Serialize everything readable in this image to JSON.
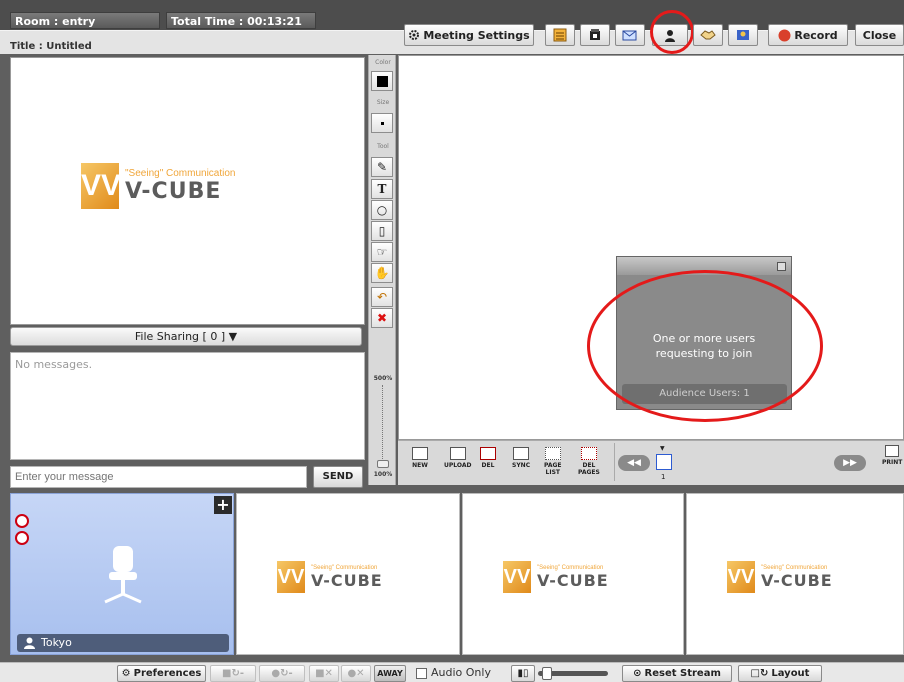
{
  "header": {
    "room": "Room : entry",
    "total_time": "Total Time : 00:13:21",
    "title": "Title : Untitled"
  },
  "toolbar": {
    "meeting_settings": "Meeting Settings",
    "record": "Record",
    "close": "Close"
  },
  "logo": {
    "tagline": "\"Seeing\" Communication",
    "brand": "V-CUBE",
    "mark": "VV"
  },
  "file_sharing": {
    "label": "File Sharing [ 0 ]"
  },
  "chat": {
    "empty_text": "No messages.",
    "input_placeholder": "Enter your message",
    "send_label": "SEND"
  },
  "tool_panel": {
    "color_label": "Color",
    "size_label": "Size",
    "tool_label": "Tool",
    "text_tool": "T",
    "zoom_max": "500%",
    "zoom_min": "100%",
    "zoom_level": 0.0
  },
  "board_toolbar": {
    "new": "NEW",
    "upload": "UPLOAD",
    "del": "DEL",
    "sync": "SYNC",
    "page_list_1": "PAGE",
    "page_list_2": "LIST",
    "del_pages_1": "DEL",
    "del_pages_2": "PAGES",
    "page_number": "1",
    "print": "PRINT"
  },
  "popup": {
    "message_line1": "One or more users",
    "message_line2": "requesting to join",
    "audience_users": "Audience Users: 1"
  },
  "participants": {
    "self_name": "Tokyo"
  },
  "bottom_bar": {
    "preferences": "Preferences",
    "away": "AWAY",
    "audio_only": "Audio Only",
    "reset_stream": "Reset Stream",
    "layout": "Layout"
  },
  "colors": {
    "accent_red": "#e41a1a",
    "record_red": "#d9402b",
    "logo_orange": "#f0a63a",
    "selected_tile": "#b7cbf2"
  }
}
